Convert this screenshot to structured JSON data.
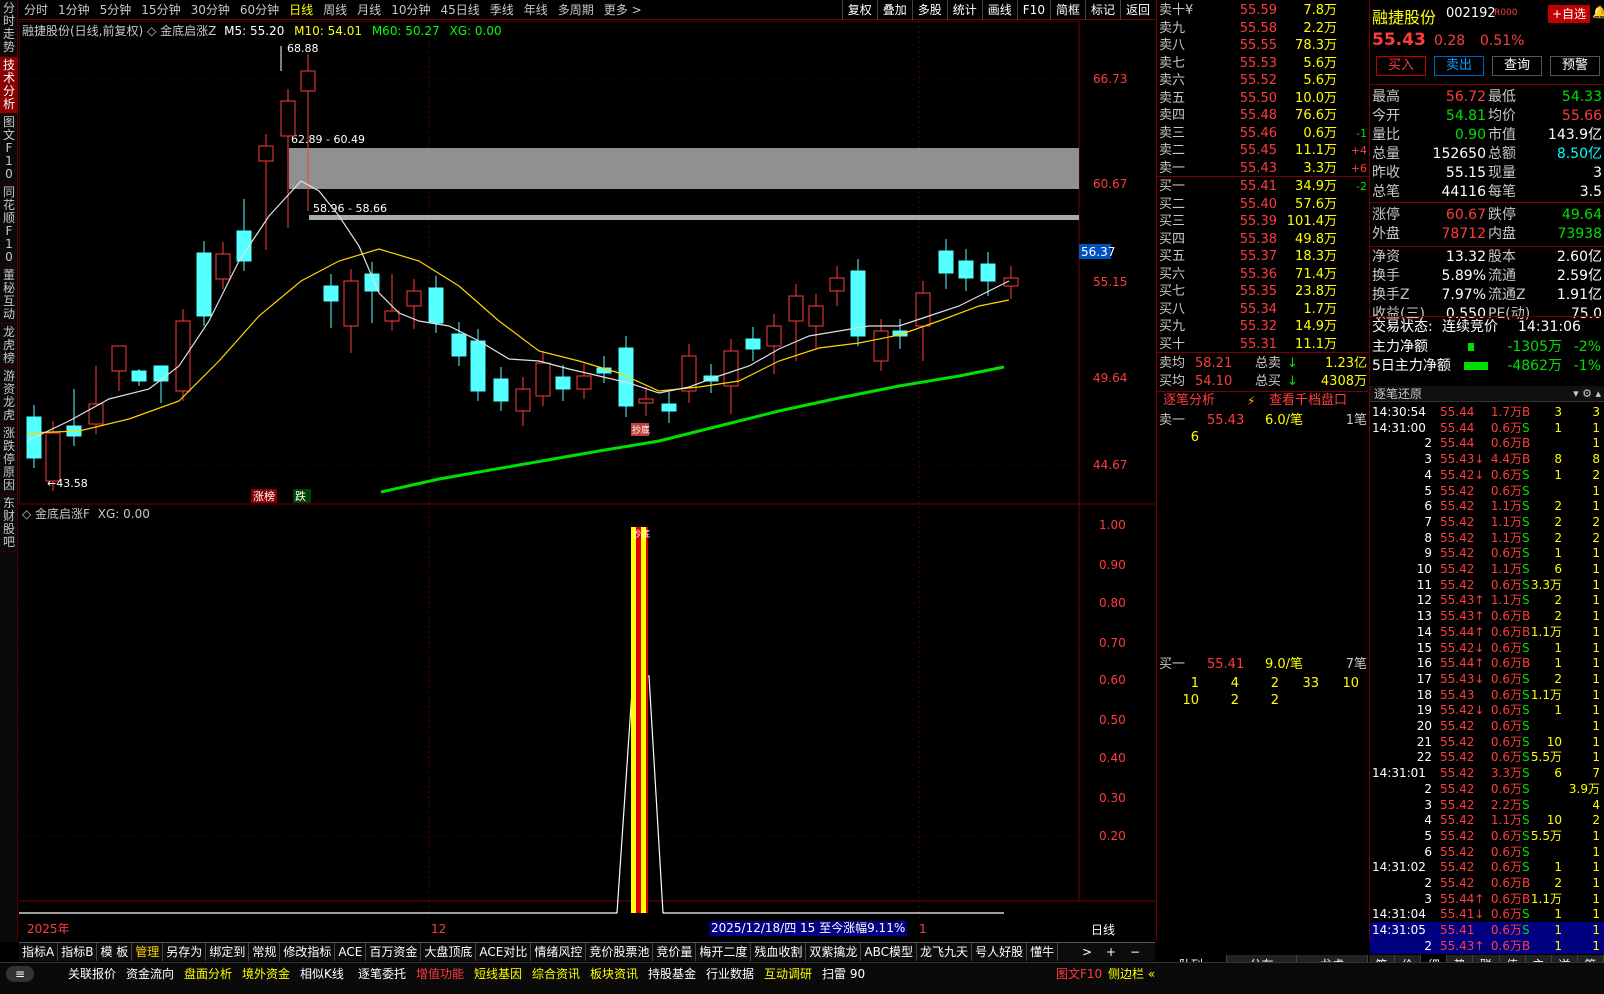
{
  "vtabs": [
    {
      "label": "分时走势"
    },
    {
      "label": "技术分析",
      "active": true
    },
    {
      "label": "图文F10"
    },
    {
      "label": "同花顺F10"
    },
    {
      "label": "董秘互动"
    },
    {
      "label": "龙虎榜"
    },
    {
      "label": "游资龙虎"
    },
    {
      "label": "涨跌停原因"
    },
    {
      "label": "东财股吧"
    }
  ],
  "periods": [
    {
      "label": "分时"
    },
    {
      "label": "1分钟"
    },
    {
      "label": "5分钟"
    },
    {
      "label": "15分钟"
    },
    {
      "label": "30分钟"
    },
    {
      "label": "60分钟"
    },
    {
      "label": "日线",
      "active": true
    },
    {
      "label": "周线"
    },
    {
      "label": "月线"
    },
    {
      "label": "10分钟"
    },
    {
      "label": "45日线"
    },
    {
      "label": "季线"
    },
    {
      "label": "年线"
    },
    {
      "label": "多周期"
    },
    {
      "label": "更多 >"
    }
  ],
  "right_buttons": [
    "复权",
    "叠加",
    "多股",
    "统计",
    "画线",
    "F10",
    "简框",
    "标记",
    "返回"
  ],
  "chart": {
    "title": "融捷股份(日线,前复权)",
    "indicator": "金底启涨Z",
    "m5": "M5: 55.20",
    "m10": "M10: 54.01",
    "m60": "M60: 50.27",
    "xg": "XG: 0.00",
    "sub_title": "金底启涨F",
    "sub_xg": "XG: 0.00",
    "price_labels": [
      "66.73",
      "60.67",
      "55.15",
      "49.64",
      "44.67"
    ],
    "current_price_tag": "56.37",
    "high_label": "68.88",
    "low_label": "43.58",
    "band1": "62.89 - 60.49",
    "band2": "58.96 - 58.66",
    "tag_zhangbang": "涨榜",
    "tag_die": "跌",
    "tag_buy": "抄底",
    "sub_labels": [
      "1.00",
      "0.90",
      "0.80",
      "0.70",
      "0.60",
      "0.50",
      "0.40",
      "0.30",
      "0.20"
    ],
    "date_labels": [
      "2025年",
      "12",
      "1"
    ],
    "date_tooltip": "2025/12/18/四 15 至今涨幅9.11%",
    "period_label": "日线"
  },
  "book": {
    "asks": [
      [
        "卖十¥",
        "55.59",
        "7.8万",
        ""
      ],
      [
        "卖九",
        "55.58",
        "2.2万",
        ""
      ],
      [
        "卖八",
        "55.55",
        "78.3万",
        ""
      ],
      [
        "卖七",
        "55.53",
        "5.6万",
        ""
      ],
      [
        "卖六",
        "55.52",
        "5.6万",
        ""
      ],
      [
        "卖五",
        "55.50",
        "10.0万",
        ""
      ],
      [
        "卖四",
        "55.48",
        "76.6万",
        ""
      ],
      [
        "卖三",
        "55.46",
        "0.6万",
        "-1"
      ],
      [
        "卖二",
        "55.45",
        "11.1万",
        "+4"
      ],
      [
        "卖一",
        "55.43",
        "3.3万",
        "+6"
      ]
    ],
    "bids": [
      [
        "买一",
        "55.41",
        "34.9万",
        "-2"
      ],
      [
        "买二",
        "55.40",
        "57.6万",
        ""
      ],
      [
        "买三",
        "55.39",
        "101.4万",
        ""
      ],
      [
        "买四",
        "55.38",
        "49.8万",
        ""
      ],
      [
        "买五",
        "55.37",
        "18.3万",
        ""
      ],
      [
        "买六",
        "55.36",
        "71.4万",
        ""
      ],
      [
        "买七",
        "55.35",
        "23.8万",
        ""
      ],
      [
        "买八",
        "55.34",
        "1.7万",
        ""
      ],
      [
        "买九",
        "55.32",
        "14.9万",
        ""
      ],
      [
        "买十",
        "55.31",
        "11.1万",
        ""
      ]
    ],
    "avg_sell_label": "卖均",
    "avg_sell": "58.21",
    "total_sell_label": "总卖",
    "total_sell": "1.23亿",
    "avg_buy_label": "买均",
    "avg_buy": "54.10",
    "total_buy_label": "总买",
    "total_buy": "4308万",
    "tick_analysis": "逐笔分析",
    "view_depth": "查看千档盘口",
    "ask1": {
      "label": "卖一",
      "price": "55.43",
      "per": "6.0/笔",
      "count": "1笔",
      "queue": [
        "6"
      ]
    },
    "bid1": {
      "label": "买一",
      "price": "55.41",
      "per": "9.0/笔",
      "count": "7笔",
      "queue": [
        "1",
        "4",
        "2",
        "33",
        "10",
        "10",
        "2",
        "2"
      ]
    }
  },
  "quote": {
    "name": "融捷股份",
    "code": "002192",
    "tag": "R000",
    "add_fav": "+自选",
    "price": "55.43",
    "change": "0.28",
    "pct": "0.51%",
    "buttons": [
      "买入",
      "卖出",
      "查询",
      "预警"
    ],
    "rows": [
      [
        "最高",
        "56.72",
        "最低",
        "54.33"
      ],
      [
        "今开",
        "54.81",
        "均价",
        "55.66"
      ],
      [
        "量比",
        "0.90",
        "市值",
        "143.9亿"
      ],
      [
        "总量",
        "152650",
        "总额",
        "8.50亿"
      ],
      [
        "昨收",
        "55.15",
        "现量",
        "3"
      ],
      [
        "总笔",
        "44116",
        "每笔",
        "3.5"
      ],
      [
        "涨停",
        "60.67",
        "跌停",
        "49.64"
      ],
      [
        "外盘",
        "78712",
        "内盘",
        "73938"
      ],
      [
        "净资",
        "13.32",
        "股本",
        "2.60亿"
      ],
      [
        "换手",
        "5.89%",
        "流通",
        "2.59亿"
      ],
      [
        "换手Z",
        "7.97%",
        "流通Z",
        "1.91亿"
      ],
      [
        "收益(三)",
        "0.550",
        "PE(动)",
        "75.0"
      ]
    ],
    "status_label": "交易状态:",
    "status": "连续竞价",
    "status_time": "14:31:06",
    "main_flow_label": "主力净额",
    "main_flow": "-1305万",
    "main_flow_pct": "-2%",
    "flow5_label": "5日主力净额",
    "flow5": "-4862万",
    "flow5_pct": "-1%"
  },
  "ticks": {
    "title": "逐笔还原",
    "rows": [
      [
        "14:30:54",
        "55.44",
        "1.7万",
        "B",
        "3",
        "3"
      ],
      [
        "14:31:00",
        "55.44",
        "0.6万",
        "S",
        "1",
        "1"
      ],
      [
        "2",
        "55.44",
        "0.6万",
        "B",
        "",
        "1"
      ],
      [
        "3",
        "55.43↓",
        "4.4万",
        "B",
        "8",
        "8"
      ],
      [
        "4",
        "55.42↓",
        "0.6万",
        "S",
        "1",
        "2"
      ],
      [
        "5",
        "55.42",
        "0.6万",
        "S",
        "",
        "1"
      ],
      [
        "6",
        "55.42",
        "1.1万",
        "S",
        "2",
        "1"
      ],
      [
        "7",
        "55.42",
        "1.1万",
        "S",
        "2",
        "2"
      ],
      [
        "8",
        "55.42",
        "1.1万",
        "S",
        "2",
        "2"
      ],
      [
        "9",
        "55.42",
        "0.6万",
        "S",
        "1",
        "1"
      ],
      [
        "10",
        "55.42",
        "1.1万",
        "S",
        "6",
        "1"
      ],
      [
        "11",
        "55.42",
        "0.6万",
        "S",
        "3.3万",
        "1"
      ],
      [
        "12",
        "55.43↑",
        "1.1万",
        "S",
        "2",
        "1"
      ],
      [
        "13",
        "55.43↑",
        "0.6万",
        "B",
        "2",
        "1"
      ],
      [
        "14",
        "55.44↑",
        "0.6万",
        "B",
        "1.1万",
        "1"
      ],
      [
        "15",
        "55.42↓",
        "0.6万",
        "S",
        "1",
        "1"
      ],
      [
        "16",
        "55.44↑",
        "0.6万",
        "B",
        "1",
        "1"
      ],
      [
        "17",
        "55.43↓",
        "0.6万",
        "S",
        "2",
        "1"
      ],
      [
        "18",
        "55.43",
        "0.6万",
        "S",
        "1.1万",
        "1"
      ],
      [
        "19",
        "55.42↓",
        "0.6万",
        "S",
        "1",
        "1"
      ],
      [
        "20",
        "55.42",
        "0.6万",
        "S",
        "",
        "1"
      ],
      [
        "21",
        "55.42",
        "0.6万",
        "S",
        "10",
        "1"
      ],
      [
        "22",
        "55.42",
        "0.6万",
        "S",
        "5.5万",
        "1"
      ],
      [
        "14:31:01",
        "55.42",
        "3.3万",
        "S",
        "6",
        "7"
      ],
      [
        "2",
        "55.42",
        "0.6万",
        "S",
        "",
        "3.9万"
      ],
      [
        "3",
        "55.42",
        "2.2万",
        "S",
        "",
        "4"
      ],
      [
        "4",
        "55.42",
        "1.1万",
        "S",
        "10",
        "2"
      ],
      [
        "5",
        "55.42",
        "0.6万",
        "S",
        "5.5万",
        "1"
      ],
      [
        "6",
        "55.42",
        "0.6万",
        "S",
        "",
        "1"
      ],
      [
        "14:31:02",
        "55.42",
        "0.6万",
        "S",
        "1",
        "1"
      ],
      [
        "2",
        "55.42",
        "0.6万",
        "B",
        "2",
        "1"
      ],
      [
        "3",
        "55.44↑",
        "0.6万",
        "B",
        "1.1万",
        "1"
      ],
      [
        "14:31:04",
        "55.41↓",
        "0.6万",
        "S",
        "1",
        "1"
      ],
      [
        "14:31:05",
        "55.41",
        "0.6万",
        "S",
        "1",
        "1"
      ],
      [
        "2",
        "55.43↑",
        "0.6万",
        "B",
        "1",
        "1"
      ]
    ]
  },
  "bottom_tabs": [
    "指标A",
    "指标B",
    "模 板",
    "管理",
    "另存为",
    "绑定到",
    "常规",
    "修改指标",
    "ACE",
    "百万资金",
    "大盘顶底",
    "ACE对比",
    "情绪风控",
    "竞价股票池",
    "竞价量",
    "梅开二度",
    "残血收割",
    "双紫擒龙",
    "ABC模型",
    "龙飞九天",
    "号人好股",
    "懂牛"
  ],
  "book_tabs": [
    "队列",
    "分布",
    "龙虎"
  ],
  "tick_tabs": [
    "笔",
    "价",
    "细",
    "势",
    "联",
    "值",
    "主",
    "逆",
    "筹"
  ],
  "status": {
    "menu": "≡",
    "items": [
      {
        "label": "关联报价",
        "c": "wht"
      },
      {
        "label": "资金流向",
        "c": "wht"
      },
      {
        "label": "盘面分析",
        "c": "yel"
      },
      {
        "label": "境外资金",
        "c": "yel"
      },
      {
        "label": "相似K线",
        "c": "wht"
      },
      {
        "label": "逐笔委托",
        "c": "wht"
      },
      {
        "label": "增值功能",
        "c": "red"
      },
      {
        "label": "短线基因",
        "c": "yel"
      },
      {
        "label": "综合资讯",
        "c": "yel"
      },
      {
        "label": "板块资讯",
        "c": "yel"
      },
      {
        "label": "持股基金",
        "c": "wht"
      },
      {
        "label": "行业数据",
        "c": "wht"
      },
      {
        "label": "互动调研",
        "c": "yel"
      },
      {
        "label": "扫雷 90",
        "c": "wht"
      }
    ],
    "right": "图文F10",
    "right2": "侧边栏 «"
  }
}
